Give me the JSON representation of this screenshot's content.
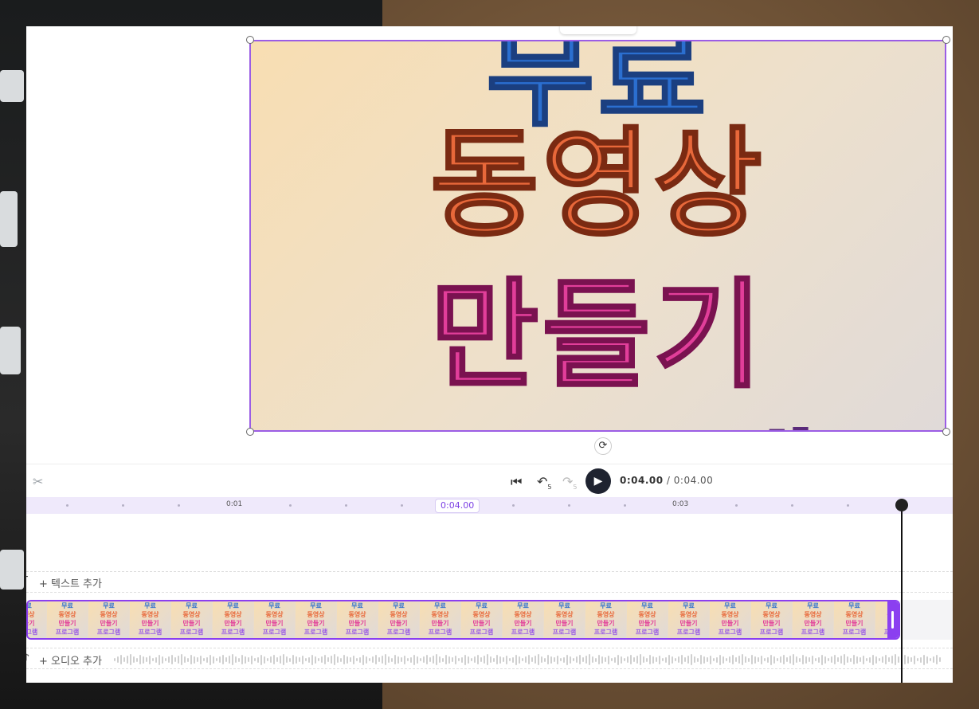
{
  "canvas": {
    "lines": [
      "무료",
      "동영상",
      "만들기",
      "프로그램"
    ]
  },
  "controls": {
    "skip_back_label": "5",
    "skip_forward_label": "5",
    "current_time": "0:04.00",
    "separator": " / ",
    "duration": "0:04.00"
  },
  "ruler": {
    "labels": [
      "0:01",
      "0:03"
    ],
    "current_badge": "0:04.00"
  },
  "tracks": {
    "add_text": "+ 텍스트 추가",
    "add_audio": "+ 오디오 추가",
    "thumb_lines": [
      "무료",
      "동영상",
      "만들기",
      "프로그램"
    ]
  },
  "colors": {
    "accent": "#8b3ff0",
    "play_button": "#1f2330"
  },
  "icons": [
    "scissors-icon",
    "skip-to-start-icon",
    "rewind-5-icon",
    "forward-5-icon",
    "play-icon",
    "rotate-icon",
    "text-track-icon",
    "music-note-icon"
  ]
}
